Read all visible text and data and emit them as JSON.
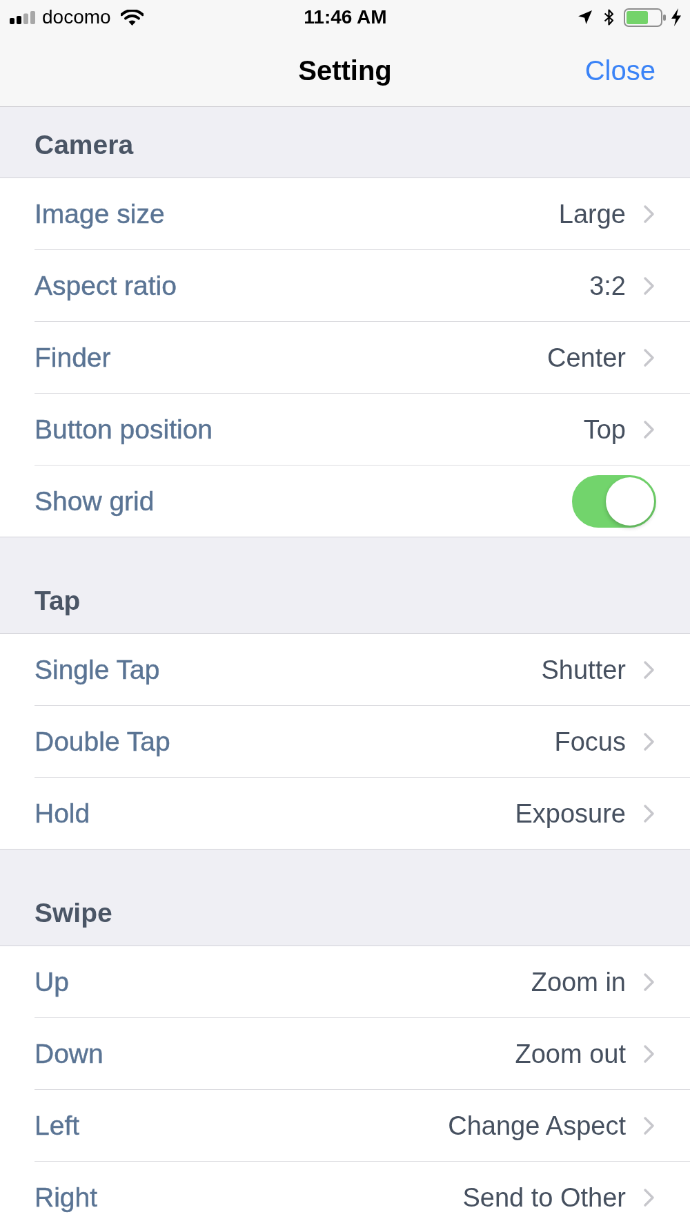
{
  "status_bar": {
    "carrier": "docomo",
    "time": "11:46 AM"
  },
  "nav_bar": {
    "title": "Setting",
    "close": "Close"
  },
  "sections": [
    {
      "title": "Camera",
      "rows": [
        {
          "kind": "value",
          "label": "Image size",
          "value": "Large"
        },
        {
          "kind": "value",
          "label": "Aspect ratio",
          "value": "3:2"
        },
        {
          "kind": "value",
          "label": "Finder",
          "value": "Center"
        },
        {
          "kind": "value",
          "label": "Button position",
          "value": "Top"
        },
        {
          "kind": "toggle",
          "label": "Show grid",
          "on": true
        }
      ]
    },
    {
      "title": "Tap",
      "rows": [
        {
          "kind": "value",
          "label": "Single Tap",
          "value": "Shutter"
        },
        {
          "kind": "value",
          "label": "Double Tap",
          "value": "Focus"
        },
        {
          "kind": "value",
          "label": "Hold",
          "value": "Exposure"
        }
      ]
    },
    {
      "title": "Swipe",
      "rows": [
        {
          "kind": "value",
          "label": "Up",
          "value": "Zoom in"
        },
        {
          "kind": "value",
          "label": "Down",
          "value": "Zoom out"
        },
        {
          "kind": "value",
          "label": "Left",
          "value": "Change Aspect"
        },
        {
          "kind": "value",
          "label": "Right",
          "value": "Send to Other"
        }
      ]
    }
  ]
}
